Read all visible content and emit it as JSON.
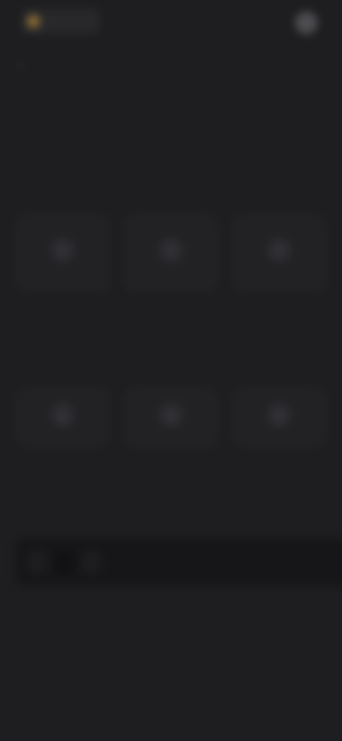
{
  "brand": {
    "name": "",
    "accent_color": "#b48a3c"
  },
  "header": {
    "top_action_label": "",
    "title": "",
    "back_icon": "arrow-left-icon"
  },
  "intro": {
    "text": ""
  },
  "sections": [
    {
      "title": "",
      "description": "",
      "options": [
        {
          "label": "",
          "icon": "circle-icon"
        },
        {
          "label": "",
          "icon": "circle-icon"
        },
        {
          "label": "",
          "icon": "circle-icon"
        }
      ]
    },
    {
      "title": "",
      "description": "",
      "options": [
        {
          "label": "",
          "icon": "triangle-icon"
        },
        {
          "label": "",
          "icon": "triangle-icon"
        },
        {
          "label": "",
          "icon": "triangle-icon"
        }
      ]
    },
    {
      "title": "",
      "description": ""
    }
  ],
  "input_bar": {
    "chips": [
      "",
      "",
      ""
    ],
    "placeholder": ""
  },
  "colors": {
    "background": "#1e1e20",
    "surface": "#232326",
    "top_action": "#56565a"
  }
}
